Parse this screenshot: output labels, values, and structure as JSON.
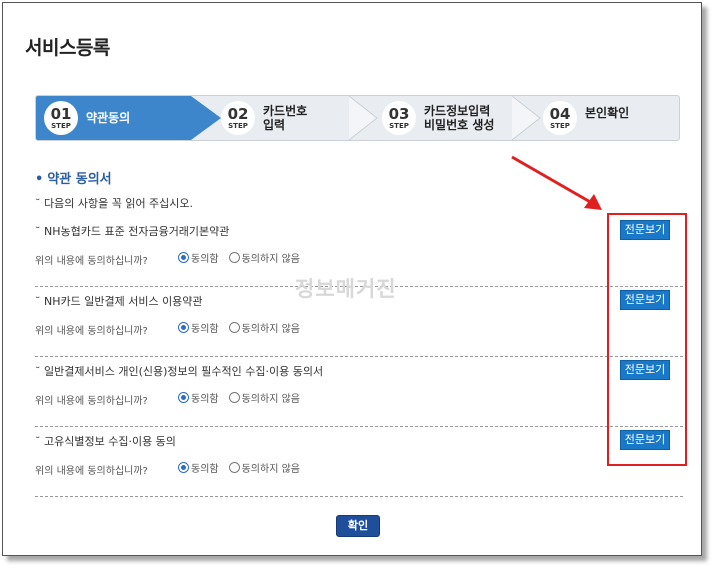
{
  "page": {
    "title": "서비스등록"
  },
  "steps": [
    {
      "num": "01",
      "word": "STEP",
      "label": "약관동의",
      "active": true
    },
    {
      "num": "02",
      "word": "STEP",
      "label": "카드번호\n입력",
      "active": false
    },
    {
      "num": "03",
      "word": "STEP",
      "label": "카드정보입력\n비밀번호 생성",
      "active": false
    },
    {
      "num": "04",
      "word": "STEP",
      "label": "본인확인",
      "active": false
    }
  ],
  "section": {
    "title": "약관 동의서",
    "bullet": "•",
    "notice": "˘ 다음의 사항을 꼭 읽어 주십시오."
  },
  "terms": [
    {
      "title": "˘ NH농협카드 표준 전자금융거래기본약관",
      "question": "위의 내용에 동의하십니까?",
      "agree": "동의함",
      "disagree": "동의하지 않음",
      "view": "전문보기"
    },
    {
      "title": "˘ NH카드 일반결제 서비스 이용약관",
      "question": "위의 내용에 동의하십니까?",
      "agree": "동의함",
      "disagree": "동의하지 않음",
      "view": "전문보기"
    },
    {
      "title": "˘ 일반결제서비스 개인(신용)정보의 필수적인 수집·이용 동의서",
      "question": "위의 내용에 동의하십니까?",
      "agree": "동의함",
      "disagree": "동의하지 않음",
      "view": "전문보기"
    },
    {
      "title": "˘ 고유식별정보 수집·이용 동의",
      "question": "위의 내용에 동의하십니까?",
      "agree": "동의함",
      "disagree": "동의하지 않음",
      "view": "전문보기"
    }
  ],
  "watermark": "정보매거진",
  "confirm": "확인",
  "colors": {
    "accent": "#3d86cc",
    "button": "#1a78c9",
    "annotation": "#e02020"
  }
}
